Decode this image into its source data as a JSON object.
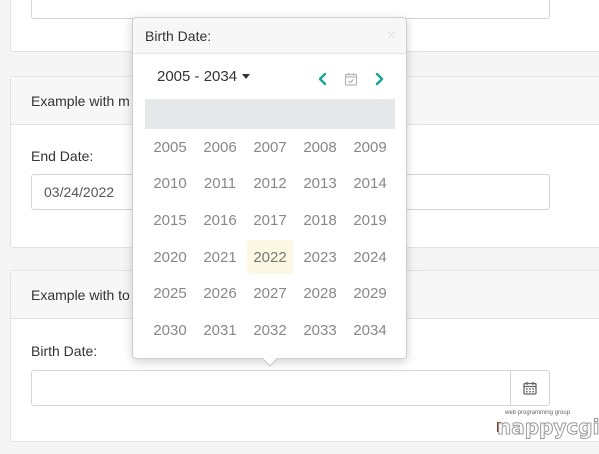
{
  "top_card": {
    "input_value": ""
  },
  "mid_card": {
    "header": "Example with m",
    "label": "End Date:",
    "input_value": "03/24/2022"
  },
  "bot_card": {
    "header": "Example with to",
    "label": "Birth Date:",
    "input_value": "",
    "button_icon": "calendar-icon"
  },
  "popup": {
    "title": "Birth Date:",
    "close_glyph": "×",
    "range_label": "2005 - 2034",
    "prev_icon": "chevron-left-icon",
    "today_icon": "calendar-check-icon",
    "next_icon": "chevron-right-icon",
    "years": [
      "2005",
      "2006",
      "2007",
      "2008",
      "2009",
      "2010",
      "2011",
      "2012",
      "2013",
      "2014",
      "2015",
      "2016",
      "2017",
      "2018",
      "2019",
      "2020",
      "2021",
      "2022",
      "2023",
      "2024",
      "2025",
      "2026",
      "2027",
      "2028",
      "2029",
      "2030",
      "2031",
      "2032",
      "2033",
      "2034"
    ],
    "current_year": "2022"
  },
  "watermark": {
    "tagline": "web programming group",
    "brand": "nappycgi"
  },
  "colors": {
    "accent": "#1aa39a",
    "highlight": "#fcf8e3",
    "strip": "#e5e8e8"
  }
}
